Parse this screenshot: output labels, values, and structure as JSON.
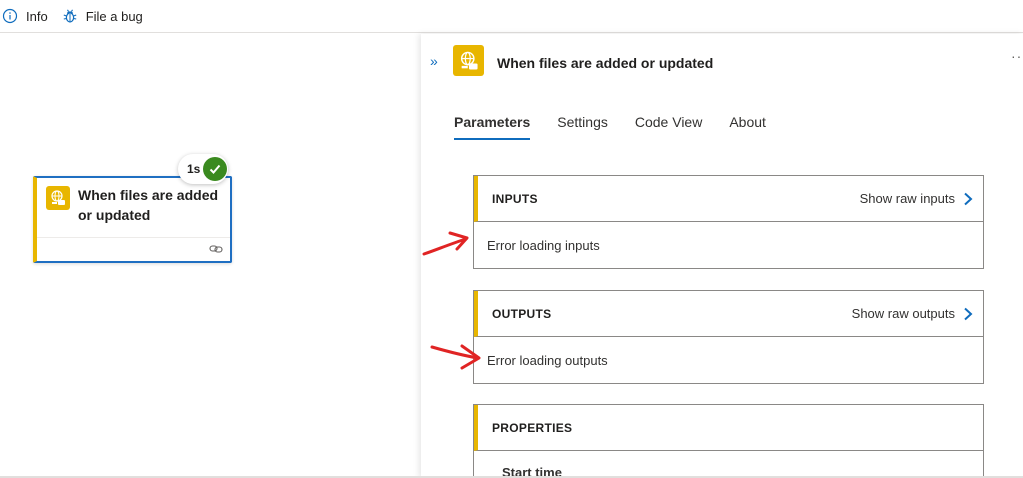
{
  "toolbar": {
    "info_label": "Info",
    "bug_label": "File a bug"
  },
  "node": {
    "title": "When files are added or updated",
    "duration": "1s",
    "status": "succeeded"
  },
  "panel": {
    "title": "When files are added or updated",
    "tabs": [
      {
        "label": "Parameters",
        "active": true
      },
      {
        "label": "Settings",
        "active": false
      },
      {
        "label": "Code View",
        "active": false
      },
      {
        "label": "About",
        "active": false
      }
    ],
    "inputs": {
      "title": "INPUTS",
      "raw_label": "Show raw inputs",
      "message": "Error loading inputs"
    },
    "outputs": {
      "title": "OUTPUTS",
      "raw_label": "Show raw outputs",
      "message": "Error loading outputs"
    },
    "properties": {
      "title": "PROPERTIES",
      "first_row": "Start time"
    }
  },
  "colors": {
    "accent": "#0f6cbd",
    "trigger_yellow": "#e8b600",
    "success_green": "#3a8a1f",
    "annotation_red": "#e02424"
  },
  "icons": [
    "info-icon",
    "bug-icon",
    "globe-connector-icon",
    "checkmark-icon",
    "link-icon",
    "collapse-chevrons-icon",
    "more-icon",
    "chevron-right-icon"
  ]
}
